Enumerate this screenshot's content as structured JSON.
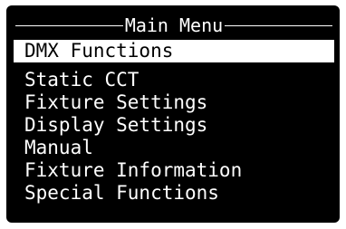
{
  "menu": {
    "title": "Main Menu",
    "selected_index": 0,
    "items": [
      {
        "label": "DMX Functions"
      },
      {
        "label": "Static CCT"
      },
      {
        "label": "Fixture Settings"
      },
      {
        "label": "Display Settings"
      },
      {
        "label": "Manual"
      },
      {
        "label": "Fixture Information"
      },
      {
        "label": "Special Functions"
      }
    ]
  },
  "colors": {
    "background": "#000000",
    "text": "#ffffff",
    "highlight": "#ffffff",
    "highlight_text": "#000000"
  }
}
